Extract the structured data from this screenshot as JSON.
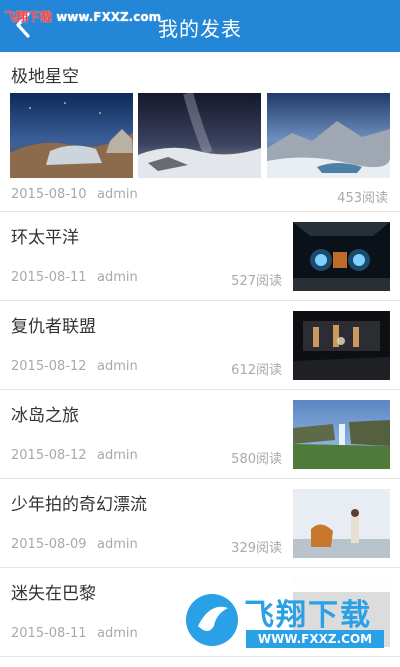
{
  "header": {
    "title": "我的发表",
    "back_icon": "chevron-left-icon",
    "color": "#2486d6"
  },
  "watermark_top": {
    "brand": "飞翔下载",
    "url": "www.FXXZ.com"
  },
  "watermark_bottom": {
    "brand": "飞翔下载",
    "site": "WWW.FXXZ.COM"
  },
  "posts": [
    {
      "title": "极地星空",
      "date": "2015-08-10",
      "author": "admin",
      "reads": "453阅读"
    },
    {
      "title": "环太平洋",
      "date": "2015-08-11",
      "author": "admin",
      "reads": "527阅读"
    },
    {
      "title": "复仇者联盟",
      "date": "2015-08-12",
      "author": "admin",
      "reads": "612阅读"
    },
    {
      "title": "冰岛之旅",
      "date": "2015-08-12",
      "author": "admin",
      "reads": "580阅读"
    },
    {
      "title": "少年拍的奇幻漂流",
      "date": "2015-08-09",
      "author": "admin",
      "reads": "329阅读"
    },
    {
      "title": "迷失在巴黎",
      "date": "2015-08-11",
      "author": "admin",
      "reads": ""
    }
  ]
}
